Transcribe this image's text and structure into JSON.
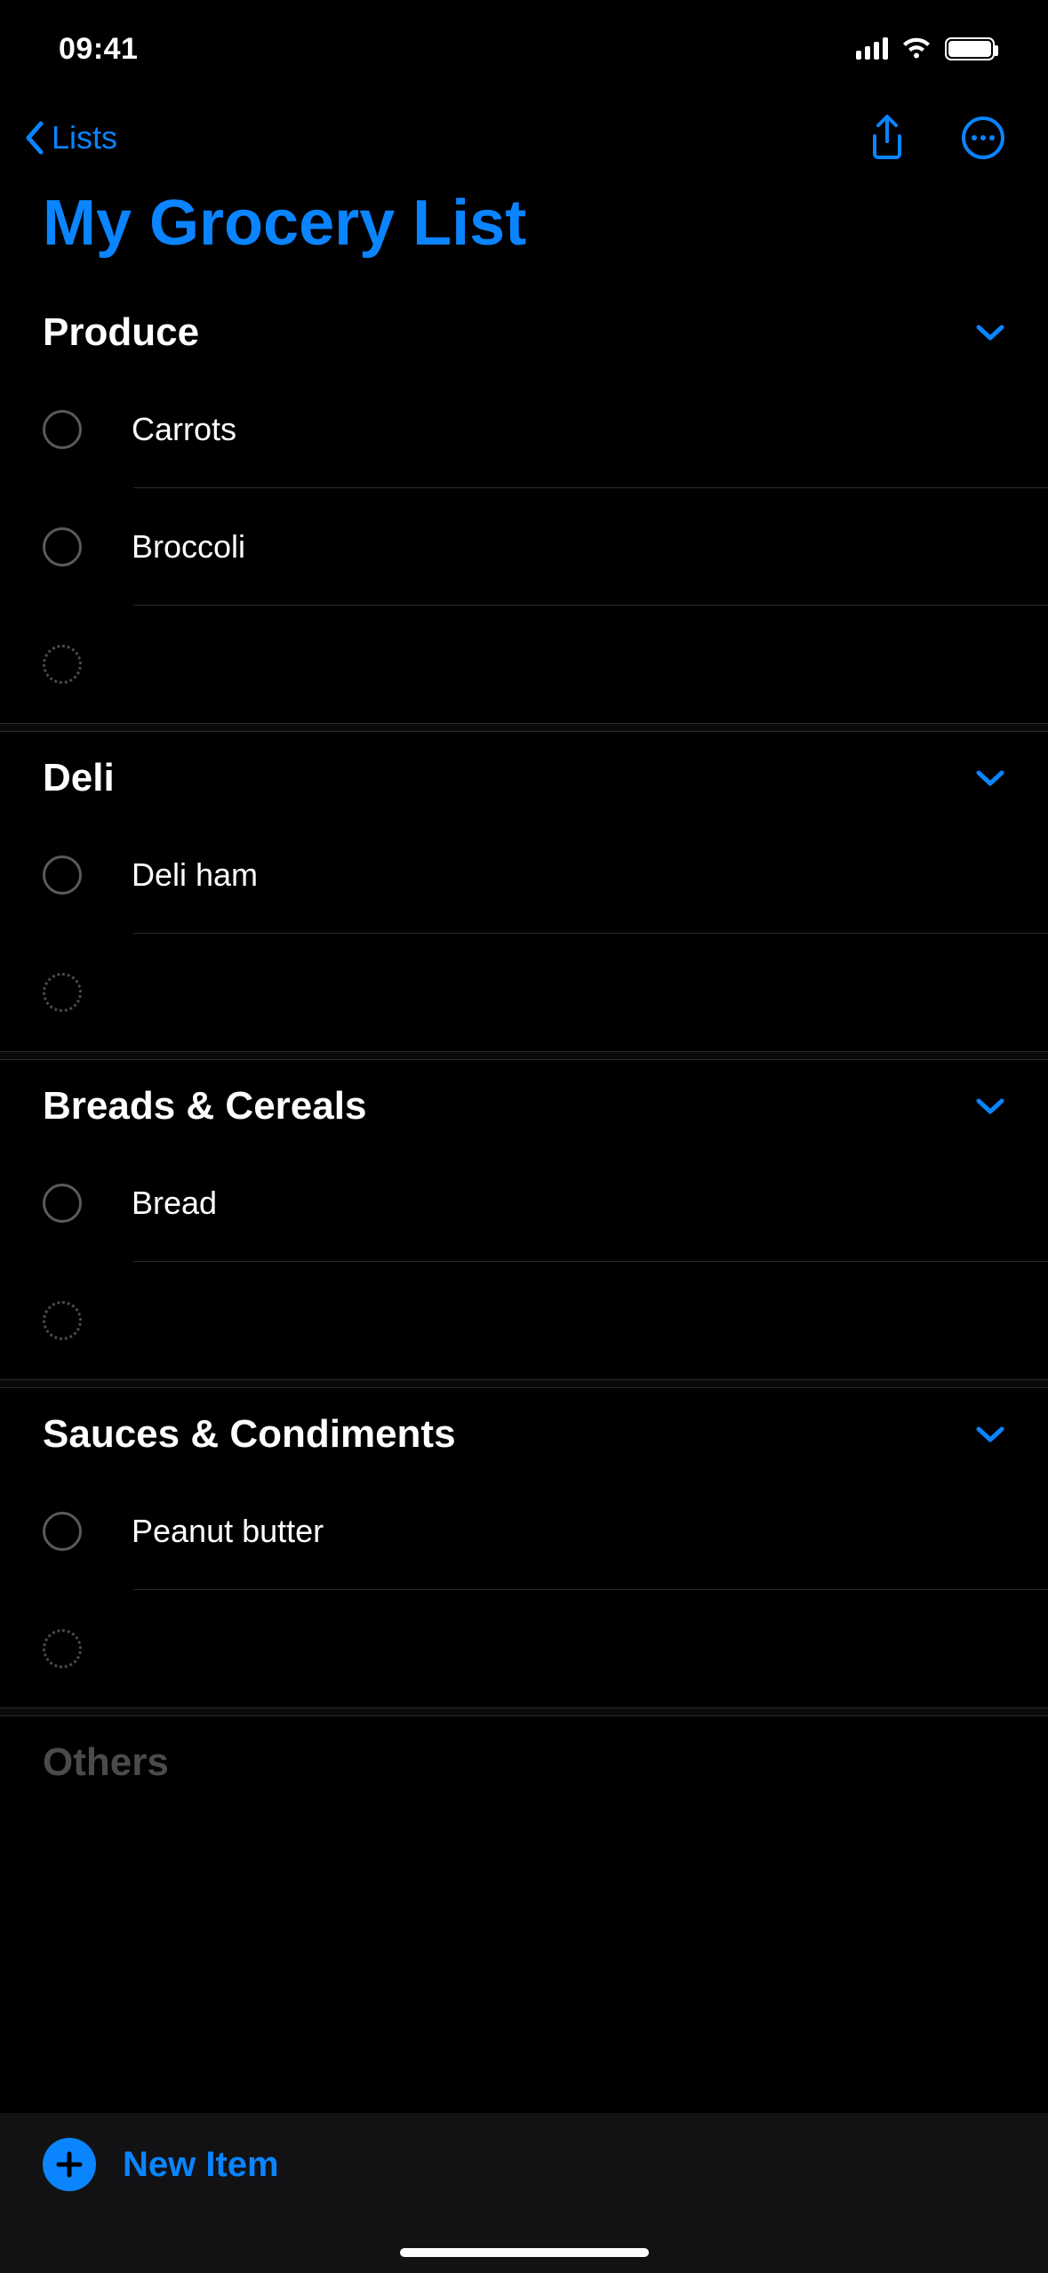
{
  "status": {
    "time": "09:41"
  },
  "nav": {
    "back_label": "Lists"
  },
  "title": "My Grocery List",
  "sections": [
    {
      "title": "Produce",
      "items": [
        "Carrots",
        "Broccoli"
      ]
    },
    {
      "title": "Deli",
      "items": [
        "Deli ham"
      ]
    },
    {
      "title": "Breads & Cereals",
      "items": [
        "Bread"
      ]
    },
    {
      "title": "Sauces & Condiments",
      "items": [
        "Peanut butter"
      ]
    },
    {
      "title": "Others",
      "items": []
    }
  ],
  "toolbar": {
    "new_item_label": "New Item"
  },
  "colors": {
    "accent": "#0a84ff"
  }
}
